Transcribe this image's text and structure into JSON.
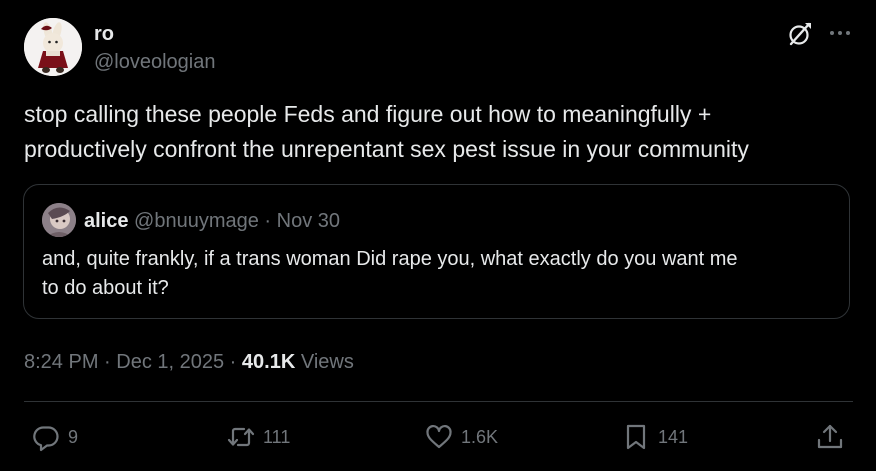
{
  "author": {
    "display_name": "ro",
    "handle": "@loveologian"
  },
  "tweet": {
    "text": "stop calling these people Feds and figure out how to meaningfully +\nproductively confront the unrepentant sex pest issue in your community"
  },
  "quoted_tweet": {
    "display_name": "alice",
    "handle": "@bnuuymage",
    "separator": " · ",
    "date": "Nov 30",
    "text": "and, quite frankly, if a trans woman Did rape you, what exactly do you want me\nto do about it?"
  },
  "meta": {
    "time": "8:24 PM",
    "separator": " · ",
    "date": "Dec 1, 2025",
    "views_count": "40.1K",
    "views_label": " Views"
  },
  "actions": {
    "replies": "9",
    "reposts": "111",
    "likes": "1.6K",
    "bookmarks": "141"
  },
  "icons": {
    "grok": "grok-icon",
    "more": "more-options-icon",
    "reply": "reply-icon",
    "repost": "repost-icon",
    "like": "heart-icon",
    "bookmark": "bookmark-icon",
    "share": "share-icon"
  },
  "colors": {
    "background": "#000000",
    "text_primary": "#e7e9ea",
    "text_secondary": "#71767b",
    "border": "#2f3336"
  }
}
